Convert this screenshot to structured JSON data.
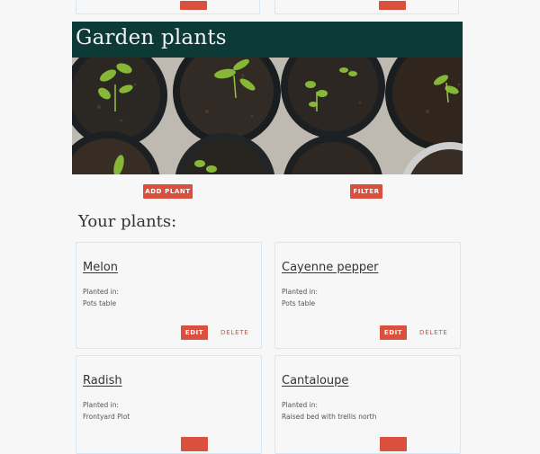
{
  "header": {
    "title": "Garden plants"
  },
  "hero": {
    "alt": "seedlings in pots"
  },
  "actions": {
    "add_plant": "ADD PLANT",
    "filter": "FILTER"
  },
  "section": {
    "title": "Your plants:"
  },
  "card_labels": {
    "planted_in": "Planted in:",
    "edit": "EDIT",
    "delete": "DELETE"
  },
  "plants": [
    {
      "name": "Melon",
      "location": "Pots table"
    },
    {
      "name": "Cayenne pepper",
      "location": "Pots table"
    },
    {
      "name": "Radish",
      "location": "Frontyard Plot"
    },
    {
      "name": "Cantaloupe",
      "location": "Raised bed with trellis north"
    }
  ],
  "colors": {
    "header_bg": "#0d3a36",
    "accent": "#d9503f",
    "card_border": "#d6e6f2"
  }
}
